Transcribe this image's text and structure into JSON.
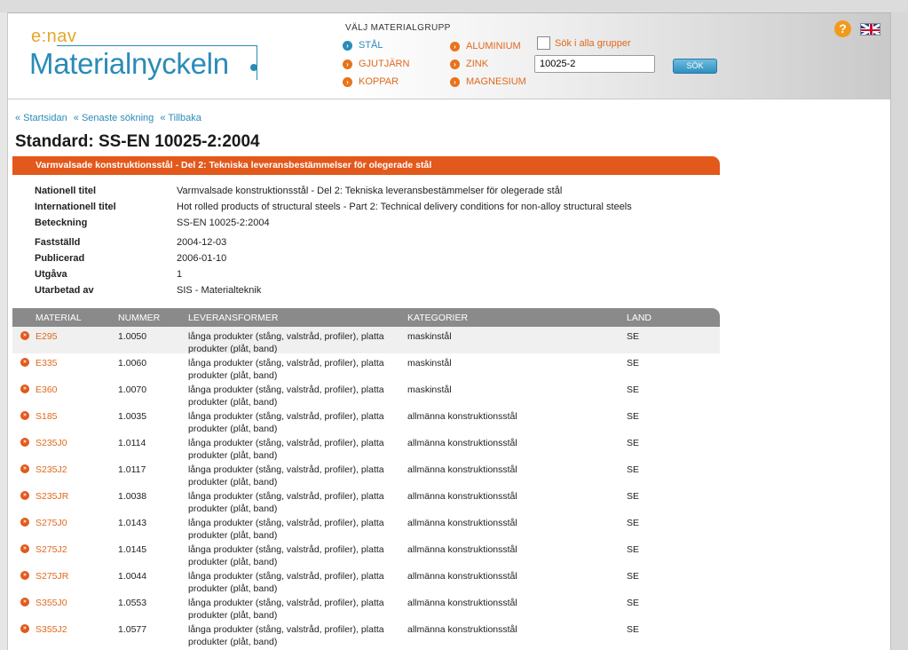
{
  "header": {
    "logo_top": "e:nav",
    "logo_main": "Materialnyckeln",
    "material_group_title": "VÄLJ MATERIALGRUPP",
    "groups": [
      "STÅL",
      "GJUTJÄRN",
      "KOPPAR",
      "ALUMINIUM",
      "ZINK",
      "MAGNESIUM"
    ],
    "search_all_label": "Sök i alla grupper",
    "search_value": "10025-2",
    "search_button": "SÖK",
    "help": "?"
  },
  "breadcrumb": [
    "« Startsidan",
    "« Senaste sökning",
    "« Tillbaka"
  ],
  "title": "Standard: SS-EN 10025-2:2004",
  "banner": "Varmvalsade konstruktionsstål - Del 2: Tekniska leveransbestämmelser för olegerade stål",
  "info": [
    {
      "label": "Nationell titel",
      "value": "Varmvalsade konstruktionsstål - Del 2: Tekniska leveransbestämmelser för olegerade stål"
    },
    {
      "label": "Internationell titel",
      "value": "Hot rolled products of structural steels - Part 2: Technical delivery conditions for non-alloy structural steels"
    },
    {
      "label": "Beteckning",
      "value": "SS-EN 10025-2:2004"
    },
    {
      "label": "Fastställd",
      "value": "2004-12-03"
    },
    {
      "label": "Publicerad",
      "value": "2006-01-10"
    },
    {
      "label": "Utgåva",
      "value": "1"
    },
    {
      "label": "Utarbetad av",
      "value": "SIS - Materialteknik"
    }
  ],
  "table": {
    "headers": [
      "MATERIAL",
      "NUMMER",
      "LEVERANSFORMER",
      "KATEGORIER",
      "LAND"
    ],
    "rows": [
      [
        "E295",
        "1.0050",
        "långa produkter (stång, valstråd, profiler), platta",
        "produkter (plåt, band)",
        "maskinstål",
        "SE"
      ],
      [
        "E335",
        "1.0060",
        "långa produkter (stång, valstråd, profiler), platta",
        "produkter (plåt, band)",
        "maskinstål",
        "SE"
      ],
      [
        "E360",
        "1.0070",
        "långa produkter (stång, valstråd, profiler), platta",
        "produkter (plåt, band)",
        "maskinstål",
        "SE"
      ],
      [
        "S185",
        "1.0035",
        "långa produkter (stång, valstråd, profiler), platta",
        "produkter (plåt, band)",
        "allmänna konstruktionsstål",
        "SE"
      ],
      [
        "S235J0",
        "1.0114",
        "långa produkter (stång, valstråd, profiler), platta",
        "produkter (plåt, band)",
        "allmänna konstruktionsstål",
        "SE"
      ],
      [
        "S235J2",
        "1.0117",
        "långa produkter (stång, valstråd, profiler), platta",
        "produkter (plåt, band)",
        "allmänna konstruktionsstål",
        "SE"
      ],
      [
        "S235JR",
        "1.0038",
        "långa produkter (stång, valstråd, profiler), platta",
        "produkter (plåt, band)",
        "allmänna konstruktionsstål",
        "SE"
      ],
      [
        "S275J0",
        "1.0143",
        "långa produkter (stång, valstråd, profiler), platta",
        "produkter (plåt, band)",
        "allmänna konstruktionsstål",
        "SE"
      ],
      [
        "S275J2",
        "1.0145",
        "långa produkter (stång, valstråd, profiler), platta",
        "produkter (plåt, band)",
        "allmänna konstruktionsstål",
        "SE"
      ],
      [
        "S275JR",
        "1.0044",
        "långa produkter (stång, valstråd, profiler), platta",
        "produkter (plåt, band)",
        "allmänna konstruktionsstål",
        "SE"
      ],
      [
        "S355J0",
        "1.0553",
        "långa produkter (stång, valstråd, profiler), platta",
        "produkter (plåt, band)",
        "allmänna konstruktionsstål",
        "SE"
      ],
      [
        "S355J2",
        "1.0577",
        "långa produkter (stång, valstråd, profiler), platta",
        "produkter (plåt, band)",
        "allmänna konstruktionsstål",
        "SE"
      ]
    ]
  }
}
